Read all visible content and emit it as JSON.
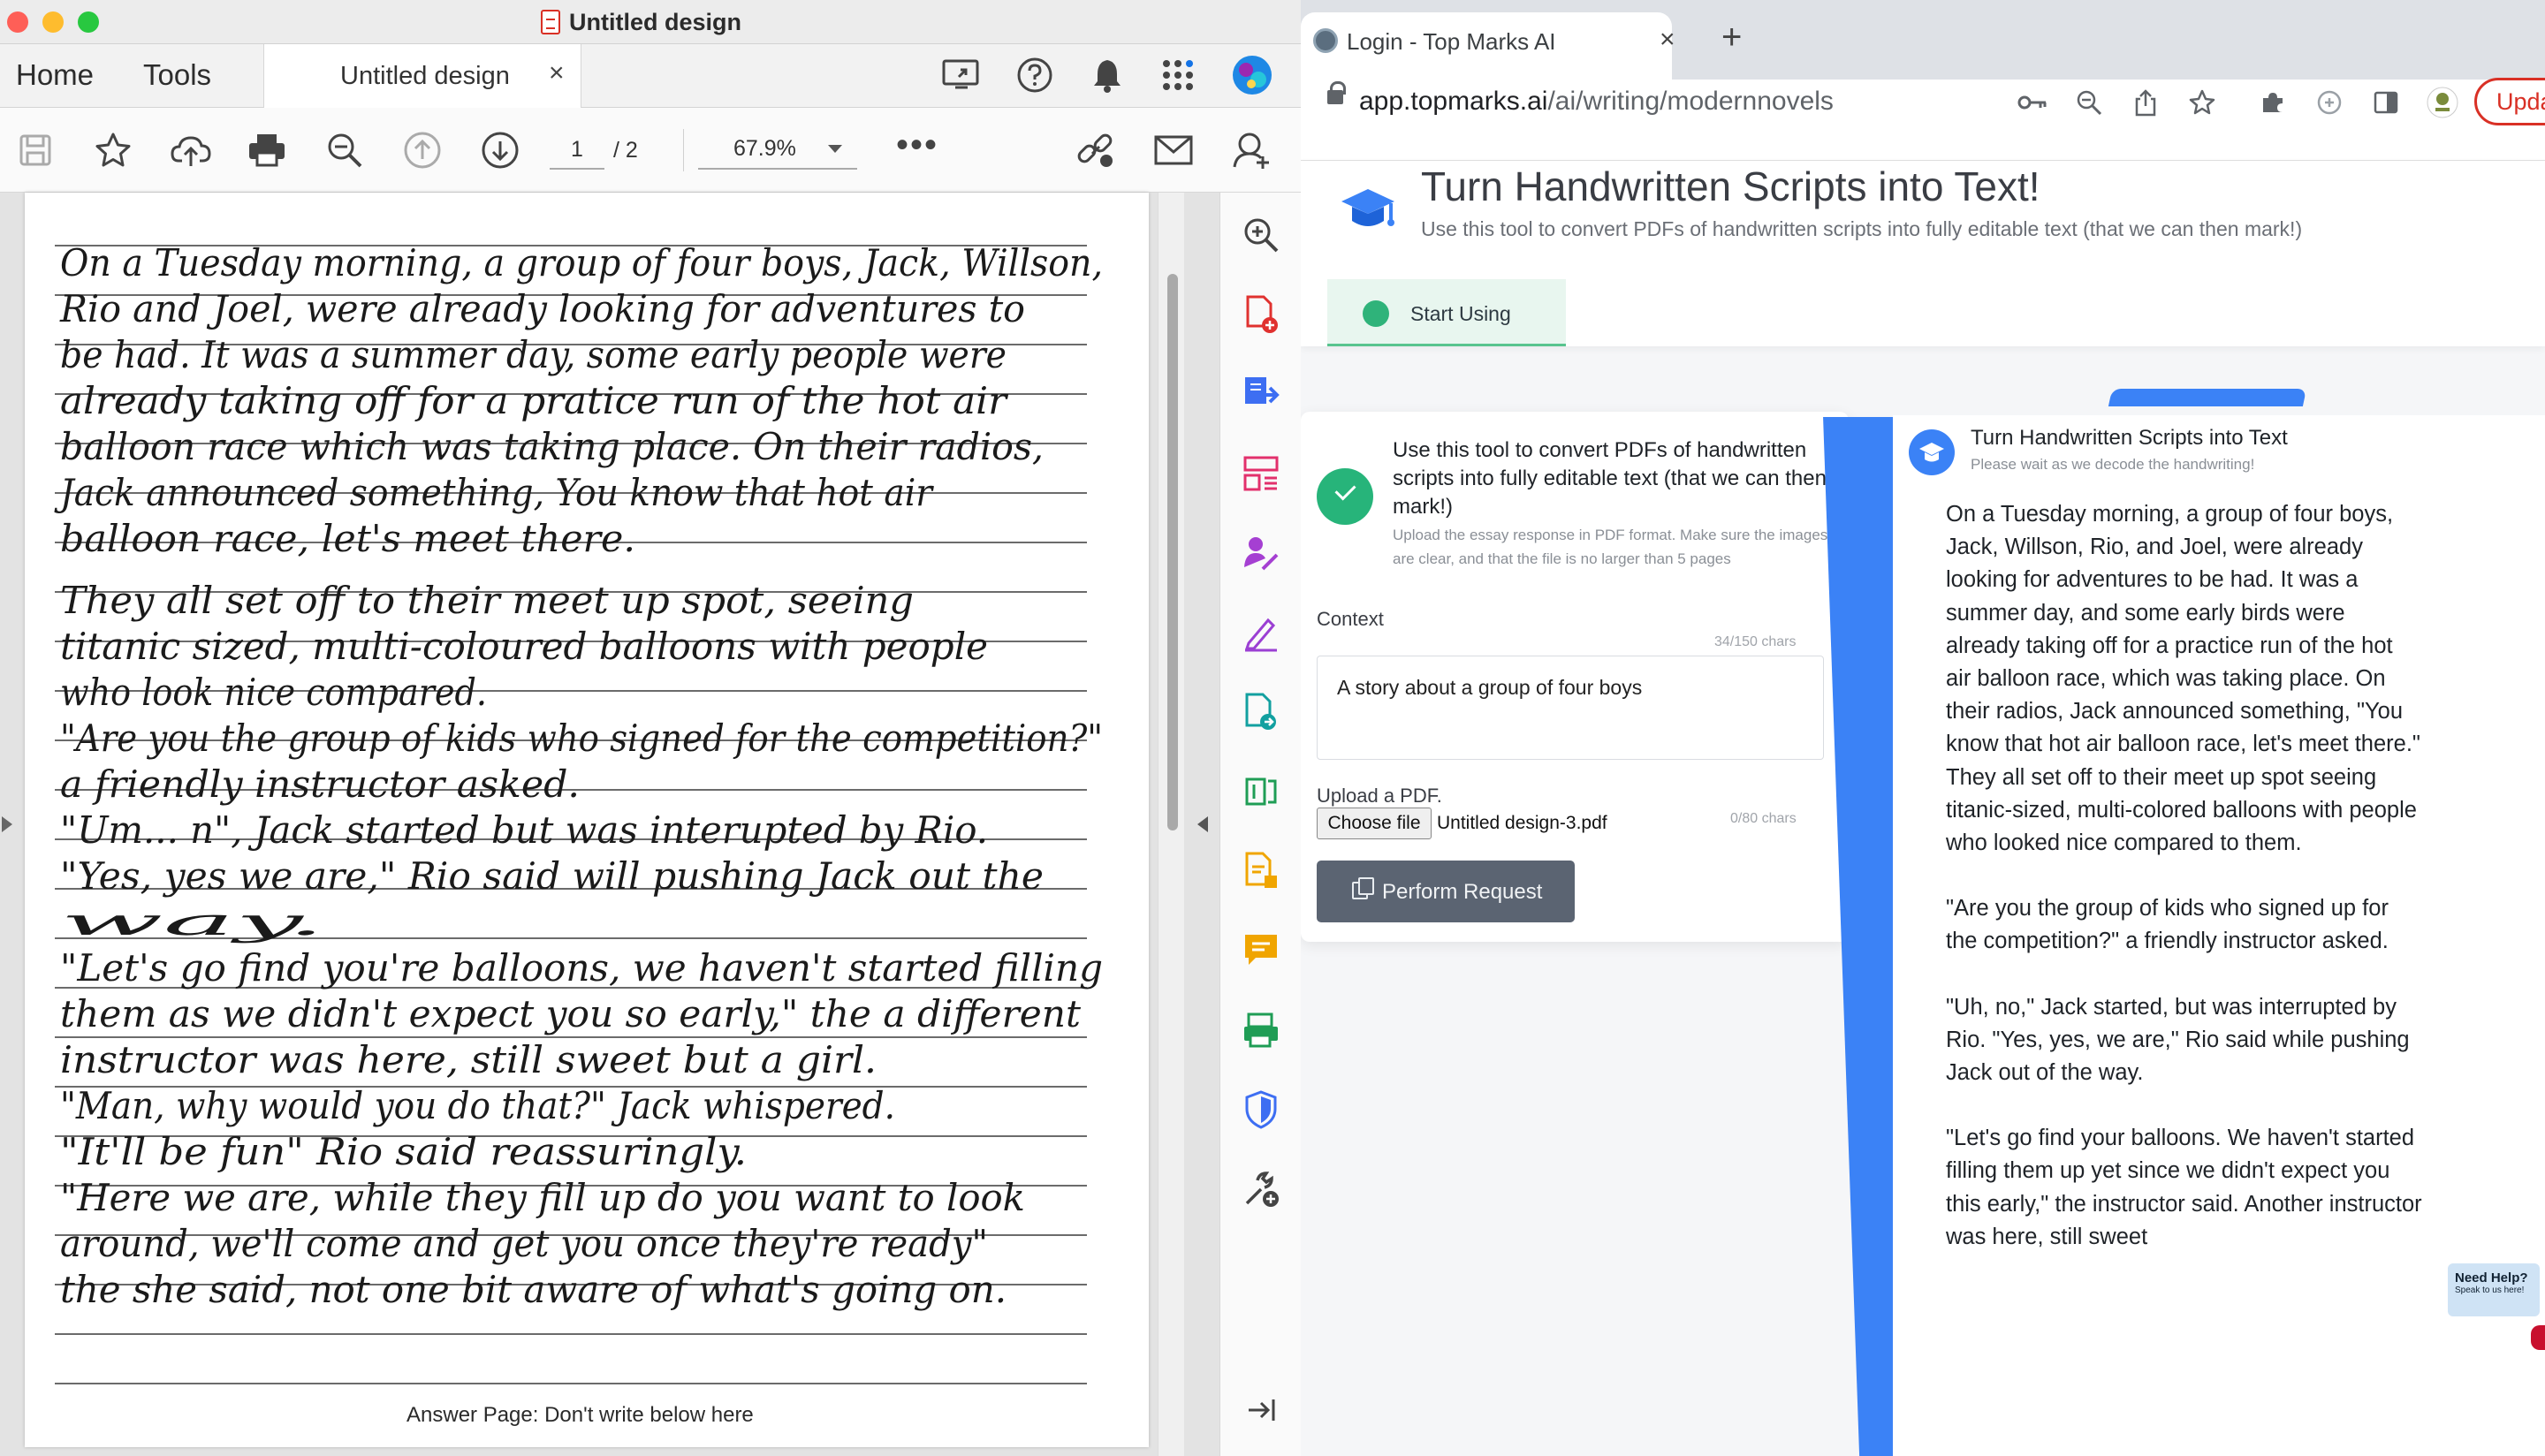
{
  "acrobat": {
    "window_title": "Untitled design",
    "nav": {
      "home": "Home",
      "tools": "Tools"
    },
    "doc_tab": {
      "label": "Untitled design",
      "close": "×"
    },
    "toolbar": {
      "page_current": "1",
      "page_total": "/ 2",
      "zoom": "67.9%",
      "more": "•••"
    },
    "document": {
      "handwriting_lines": [
        "On a Tuesday morning, a group of four boys, Jack, Willson,",
        "Rio and Joel, were already looking for adventures to",
        "be had. It was a summer day, some early people were",
        "already taking off for a pratice run of the hot air",
        "balloon race which was taking place. On their radios,",
        "Jack announced something, You know that hot air",
        "balloon race, let's meet there.",
        "They all set off to their meet up spot, seeing",
        "titanic sized, multi-coloured balloons with people",
        "who look nice compared.",
        "\"Are you the group of kids who signed for the competition?\"",
        "a friendly instructor asked.",
        "\"Um... n\", Jack started but was interupted by Rio.",
        "\"Yes, yes we are,\" Rio said will pushing Jack out the",
        "way.",
        "\"Let's go find you're balloons, we haven't started filling",
        "them as we didn't expect you so early,\" the a different",
        "instructor was here, still sweet but a girl.",
        "\"Man, why would you do that?\" Jack whispered.",
        "\"It'll be fun\" Rio said reassuringly.",
        "\"Here we are, while they fill up do you want to look",
        "around, we'll come and get you once they're ready\"",
        "the she said, not one bit aware of what's going on."
      ],
      "footer": "Answer Page: Don't write below here"
    }
  },
  "browser": {
    "tab": {
      "title": "Login - Top Marks AI",
      "close": "×"
    },
    "new_tab": "+",
    "url": {
      "host": "app.topmarks.ai",
      "path": "/ai/writing/modernnovels"
    },
    "update_button": "Upda"
  },
  "site": {
    "hero": {
      "title": "Turn Handwritten Scripts into Text!",
      "subtitle": "Use this tool to convert PDFs of handwritten scripts into fully editable text (that we can then mark!)",
      "start_tab": "Start Using"
    },
    "form": {
      "heading": "Use this tool to convert PDFs of handwritten scripts into fully editable text (that we can then mark!)",
      "help": "Upload the essay response in PDF format. Make sure the images are clear, and that the file is no larger than 5 pages",
      "context_label": "Context",
      "context_count": "34/150 chars",
      "context_value": "A story about a group of four boys",
      "upload_label": "Upload a PDF.",
      "choose_file": "Choose file",
      "file_name": "Untitled design-3.pdf",
      "upload_count": "0/80 chars",
      "submit": "Perform Request"
    },
    "output": {
      "title": "Turn Handwritten Scripts into Text",
      "subtitle": "Please wait as we decode the handwriting!",
      "paragraphs": [
        "On a Tuesday morning, a group of four boys, Jack, Willson, Rio, and Joel, were already looking for adventures to be had. It was a summer day, and some early birds were already taking off for a practice run of the hot air balloon race, which was taking place. On their radios, Jack announced something, \"You know that hot air balloon race, let's meet there.\" They all set off to their meet up spot seeing titanic-sized, multi-colored balloons with people who looked nice compared to them.",
        "\"Are you the group of kids who signed up for the competition?\" a friendly instructor asked.",
        "\"Uh, no,\" Jack started, but was interrupted by Rio. \"Yes, yes, we are,\" Rio said while pushing Jack out of the way.",
        "\"Let's go find your balloons. We haven't started filling them up yet since we didn't expect you this early,\" the instructor said. Another instructor was here, still sweet"
      ]
    },
    "help_widget": {
      "title": "Need Help?",
      "subtitle": "Speak to us here!"
    }
  },
  "colors": {
    "accent_blue": "#3b82f6",
    "success_green": "#27b47a",
    "acrobat_red": "#d93025",
    "button_gray": "#5b6472"
  }
}
